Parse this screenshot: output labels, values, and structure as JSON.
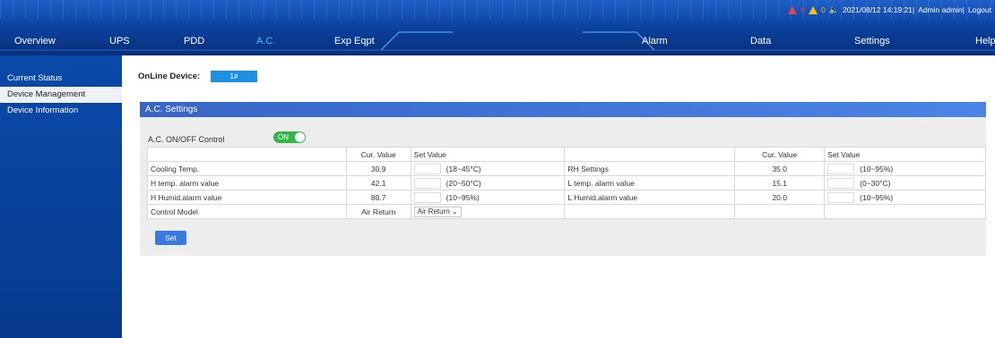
{
  "status": {
    "alarm_red_count": "0",
    "alarm_yellow_count": "0",
    "sound_icon": "speaker-icon",
    "datetime": "2021/08/12 14:19:21|",
    "admin": "Admin admin|",
    "logout": "Logout"
  },
  "nav": {
    "items": [
      {
        "label": "Overview"
      },
      {
        "label": "UPS"
      },
      {
        "label": "PDD"
      },
      {
        "label": "A.C."
      },
      {
        "label": "Exp Eqpt"
      },
      {
        "label": "Alarm"
      },
      {
        "label": "Data"
      },
      {
        "label": "Settings"
      },
      {
        "label": "Help"
      }
    ],
    "active": "A.C."
  },
  "sidebar": {
    "items": [
      {
        "label": "Current Status"
      },
      {
        "label": "Device Management"
      },
      {
        "label": "Device Information"
      }
    ]
  },
  "main": {
    "online_label": "OnLine Device:",
    "online_device": "1#",
    "panel_title": "A.C. Settings",
    "onoff_label": "A.C. ON/OFF Control",
    "toggle_text": "ON",
    "table": {
      "headers": {
        "cur": "Cur. Value",
        "set": "Set Value"
      },
      "left_rows": [
        {
          "label": "Cooling Temp.",
          "cur": "30.9",
          "range": "(18~45°C)"
        },
        {
          "label": "H temp. alarm value",
          "cur": "42.1",
          "range": "(20~50°C)"
        },
        {
          "label": "H Humid.alarm value",
          "cur": "80.7",
          "range": "(10~95%)"
        },
        {
          "label": "Control Model",
          "cur": "Air Return",
          "select": "Air Return"
        }
      ],
      "right_rows": [
        {
          "label": "RH Settings",
          "cur": "35.0",
          "range": "(10~95%)"
        },
        {
          "label": "L temp. alarm value",
          "cur": "15.1",
          "range": "(0~30°C)"
        },
        {
          "label": "L Humid.alarm value",
          "cur": "20.0",
          "range": "(10~95%)"
        }
      ]
    },
    "set_button": "Set"
  },
  "colors": {
    "header": "#0b3f9a",
    "sidebar": "#0a4aaa",
    "active_nav": "#4fc0ff",
    "toggle_on": "#35b54a",
    "panel_head": "#3765c8",
    "button": "#3a79e0"
  }
}
